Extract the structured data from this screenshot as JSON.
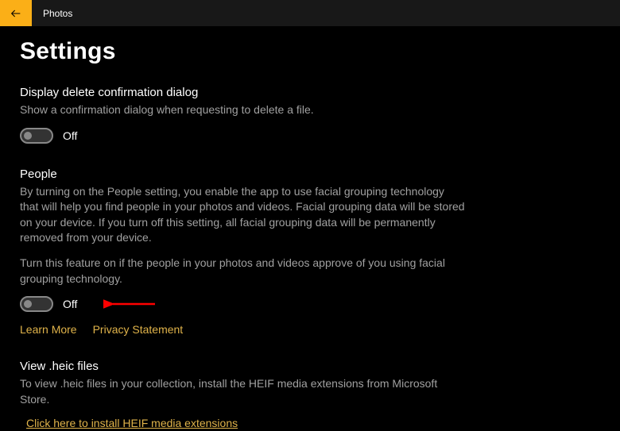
{
  "header": {
    "app_title": "Photos"
  },
  "page": {
    "title": "Settings"
  },
  "sections": {
    "delete_confirm": {
      "title": "Display delete confirmation dialog",
      "description": "Show a confirmation dialog when requesting to delete a file.",
      "toggle_state": "Off"
    },
    "people": {
      "title": "People",
      "description": "By turning on the People setting, you enable the app to use facial grouping technology that will help you find people in your photos and videos. Facial grouping data will be stored on your device. If you turn off this setting, all facial grouping data will be permanently removed from your device.",
      "description2": "Turn this feature on if the people in your photos and videos approve of you using facial grouping technology.",
      "toggle_state": "Off",
      "learn_more": "Learn More",
      "privacy": "Privacy Statement"
    },
    "heic": {
      "title": "View .heic files",
      "description": "To view .heic files in your collection, install the HEIF media extensions from Microsoft Store.",
      "link": "Click here to install HEIF media extensions"
    }
  }
}
